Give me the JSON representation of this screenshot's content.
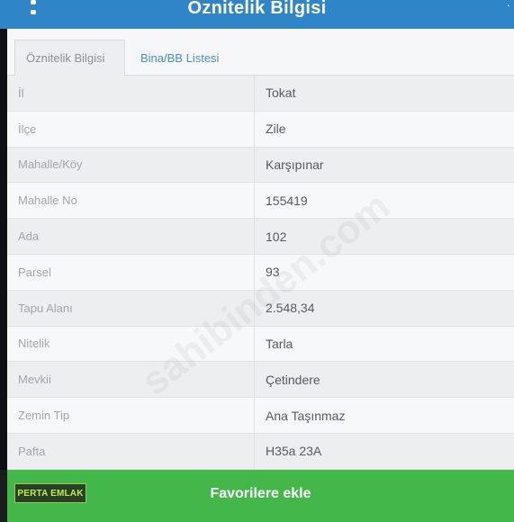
{
  "header": {
    "title": "Öznitelik Bilgisi"
  },
  "tabs": [
    {
      "label": "Öznitelik Bilgisi",
      "active": true
    },
    {
      "label": "Bina/BB Listesi",
      "active": false
    }
  ],
  "rows": [
    {
      "label": "İl",
      "value": "Tokat"
    },
    {
      "label": "İlçe",
      "value": "Zile"
    },
    {
      "label": "Mahalle/Köy",
      "value": "Karşıpınar"
    },
    {
      "label": "Mahalle No",
      "value": "155419"
    },
    {
      "label": "Ada",
      "value": "102"
    },
    {
      "label": "Parsel",
      "value": "93"
    },
    {
      "label": "Tapu Alanı",
      "value": "2.548,34"
    },
    {
      "label": "Nitelik",
      "value": "Tarla"
    },
    {
      "label": "Mevkii",
      "value": "Çetindere"
    },
    {
      "label": "Zemin Tip",
      "value": "Ana Taşınmaz"
    },
    {
      "label": "Pafta",
      "value": "H35a 23A"
    }
  ],
  "watermark": "sahibinden.com",
  "footer": {
    "button_label": "Favorilere ekle",
    "stamp_text": "PERTA EMLAK"
  },
  "colors": {
    "header": "#2e86c9",
    "footer_button": "#43b74a",
    "tab_link": "#4c8cc6"
  }
}
